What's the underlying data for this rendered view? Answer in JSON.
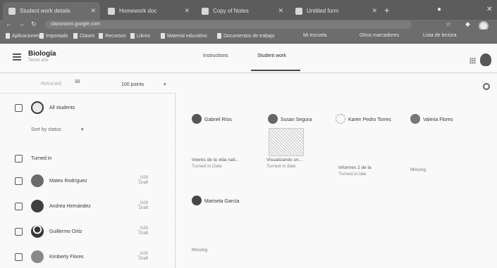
{
  "browser": {
    "tabs": [
      {
        "label": "Student work details"
      },
      {
        "label": "Homework doc"
      },
      {
        "label": "Copy of Notes"
      },
      {
        "label": "Untitled form"
      }
    ],
    "url": "classroom.google.com",
    "bookmarks": [
      {
        "label": "Aplicaciones"
      },
      {
        "label": "Importado"
      },
      {
        "label": "Clases"
      },
      {
        "label": "Recursos"
      },
      {
        "label": "Libros"
      },
      {
        "label": "Material educativo"
      },
      {
        "label": "Documentos de trabajo"
      },
      {
        "label": "Mi escuela"
      },
      {
        "label": "Otros marcadores"
      },
      {
        "label": "Lista de lectura"
      }
    ]
  },
  "header": {
    "course_title": "Biología",
    "course_subtitle": "Tercer año",
    "tabs": [
      {
        "label": "Instructions"
      },
      {
        "label": "Student work"
      }
    ]
  },
  "toolbar": {
    "sort_label": "Returned",
    "points_label": "100 points"
  },
  "list": {
    "all_students_label": "All students",
    "sort_status_label": "Sort by status",
    "turned_in_label": "Turned in",
    "students": [
      {
        "name": "Mateo Rodríguez",
        "grade": "_/100",
        "sub": "Draft"
      },
      {
        "name": "Andrea Hernández",
        "grade": "_/100",
        "sub": "Draft"
      },
      {
        "name": "Guillermo Ortiz",
        "grade": "_/100",
        "sub": "Draft"
      },
      {
        "name": "Kimberly Flores",
        "grade": "_/100",
        "sub": "Draft"
      }
    ]
  },
  "cards": [
    {
      "name": "Gabriel Ríos",
      "line1": "Interés de la vida nati...",
      "line2": "Turned in Date",
      "state": ""
    },
    {
      "name": "Susan Segura",
      "line1": "Visualizando un...",
      "line2": "Turned in date",
      "state": ""
    },
    {
      "name": "Karen Pedro Torres",
      "line1": "Informes 2 de la",
      "line2": "Turned in late",
      "state": ""
    },
    {
      "name": "Valeria Flores",
      "line1": "",
      "line2": "",
      "state": "Missing"
    },
    {
      "name": "Marisela García",
      "line1": "",
      "line2": "",
      "state": "Missing"
    }
  ]
}
